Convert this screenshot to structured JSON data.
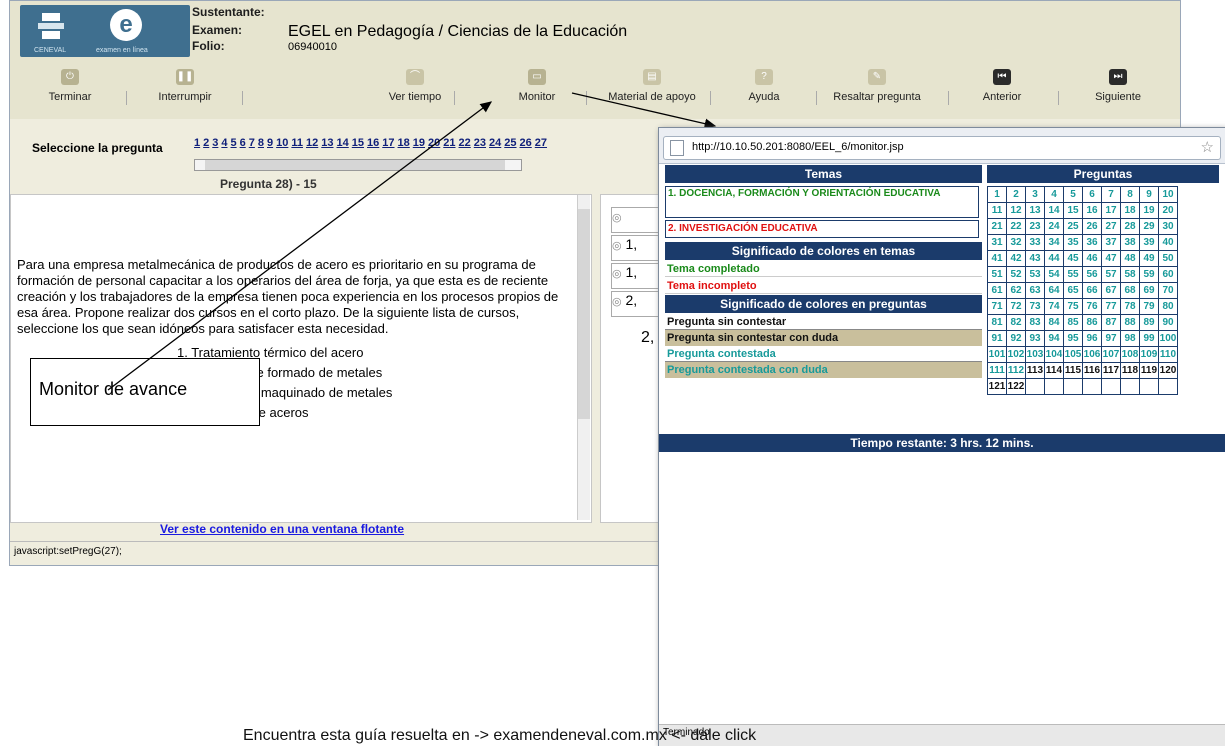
{
  "header": {
    "logo_caption_left": "CENEVAL",
    "logo_caption_right": "examen en línea",
    "sustentante_label": "Sustentante:",
    "examen_label": "Examen:",
    "folio_label": "Folio:",
    "examen_value": "EGEL en Pedagogía / Ciencias de la Educación",
    "folio_value": "06940010"
  },
  "toolbar": {
    "terminar": "Terminar",
    "interrumpir": "Interrumpir",
    "ver_tiempo": "Ver tiempo",
    "monitor": "Monitor",
    "material": "Material de apoyo",
    "ayuda": "Ayuda",
    "resaltar": "Resaltar pregunta",
    "anterior": "Anterior",
    "siguiente": "Siguiente"
  },
  "select": {
    "label": "Seleccione la pregunta",
    "numbers": [
      "1",
      "2",
      "3",
      "4",
      "5",
      "6",
      "7",
      "8",
      "9",
      "10",
      "11",
      "12",
      "13",
      "14",
      "15",
      "16",
      "17",
      "18",
      "19",
      "20",
      "21",
      "22",
      "23",
      "24",
      "25",
      "26",
      "27"
    ],
    "question_title": "Pregunta 28) - 15"
  },
  "question": {
    "text": "Para una empresa metalmecánica de productos de acero es prioritario en su programa de formación de personal capacitar a los operarios del área de forja, ya que esta es de reciente creación y los trabajadores de la empresa tienen poca experiencia en los procesos propios de esa área. Propone realizar dos cursos en el corto plazo. De la siguiente lista de cursos, seleccione los que sean idóneos para satisfacer esta necesidad.",
    "item1": "1. Tratamiento térmico del acero",
    "item2": "2. Procesos de formado de metales",
    "item3": "de maquinado de metales",
    "item4": "ón de aceros",
    "float_link": "Ver este contenido en una ventana flotante"
  },
  "options": [
    "",
    "1,",
    "1,",
    "2,",
    "2,"
  ],
  "status": "javascript:setPregG(27);",
  "callout": "Monitor de avance",
  "popup": {
    "url": "http://10.10.50.201:8080/EEL_6/monitor.jsp",
    "temas_header": "Temas",
    "preguntas_header": "Preguntas",
    "tema1": "1. DOCENCIA, FORMACIÓN Y ORIENTACIÓN EDUCATIVA",
    "tema2": "2. INVESTIGACIÓN EDUCATIVA",
    "sig_temas": "Significado de colores en temas",
    "completado": "Tema completado",
    "incompleto": "Tema incompleto",
    "sig_preg": "Significado de colores en preguntas",
    "sin_contestar": "Pregunta sin contestar",
    "sin_contestar_duda": "Pregunta sin contestar con duda",
    "contestada": "Pregunta contestada",
    "contestada_duda": "Pregunta contestada con duda",
    "tiempo": "Tiempo restante: 3 hrs. 12 mins.",
    "status": "Terminado",
    "answered_through": 112,
    "total_questions": 122
  },
  "footer": "Encuentra esta guía resuelta en -> examendeneval.com.mx <- dale click",
  "colors": {
    "navy": "#1b3b6b",
    "teal": "#179a9a",
    "green": "#1a8a1a",
    "red": "#e01010",
    "tan": "#c9bf9c"
  }
}
